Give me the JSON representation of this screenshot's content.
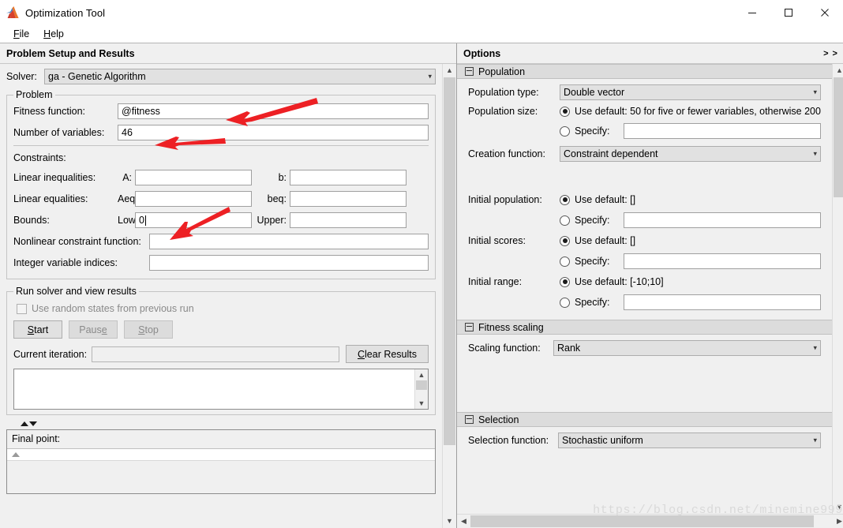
{
  "window": {
    "title": "Optimization Tool",
    "icon": "matlab-membrane-icon",
    "minimize_label": "–",
    "maximize_label": "□",
    "close_label": "✕"
  },
  "menubar": {
    "items": [
      {
        "label": "File",
        "mnemonic": "F"
      },
      {
        "label": "Help",
        "mnemonic": "H"
      }
    ]
  },
  "left_pane": {
    "header": "Problem Setup and Results",
    "solver": {
      "label": "Solver:",
      "value": "ga - Genetic Algorithm"
    },
    "problem": {
      "legend": "Problem",
      "fitness_function": {
        "label": "Fitness function:",
        "value": "@fitness"
      },
      "number_of_variables": {
        "label": "Number of variables:",
        "value": "46"
      },
      "constraints_label": "Constraints:",
      "linear_inequalities": {
        "label": "Linear inequalities:",
        "a_label": "A:",
        "a_value": "",
        "b_label": "b:",
        "b_value": ""
      },
      "linear_equalities": {
        "label": "Linear equalities:",
        "aeq_label": "Aeq:",
        "aeq_value": "",
        "beq_label": "beq:",
        "beq_value": ""
      },
      "bounds": {
        "label": "Bounds:",
        "lower_label": "Lower:",
        "lower_value": "0",
        "upper_label": "Upper:",
        "upper_value": ""
      },
      "nonlinear_constraint": {
        "label": "Nonlinear constraint function:",
        "value": ""
      },
      "integer_variable_indices": {
        "label": "Integer variable indices:",
        "value": ""
      }
    },
    "run_solver": {
      "legend": "Run solver and view results",
      "use_random_states": {
        "label": "Use random states from previous run",
        "checked": false,
        "disabled": true
      },
      "start_button": "Start",
      "pause_button": "Pause",
      "stop_button": "Stop",
      "current_iteration": {
        "label": "Current iteration:",
        "value": ""
      },
      "clear_results_button": "Clear Results",
      "results_text": ""
    },
    "final_point": {
      "label": "Final point:",
      "value": ""
    }
  },
  "right_pane": {
    "header": "Options",
    "expander": "> >",
    "sections": [
      {
        "name": "Population",
        "rows": [
          {
            "type": "combo",
            "label": "Population type:",
            "value": "Double vector"
          },
          {
            "type": "radio_default",
            "label": "Population size:",
            "default_text": "Use default: 50 for five or fewer variables, otherwise 200",
            "selected": "default"
          },
          {
            "type": "radio_specify",
            "label": "",
            "specify_text": "Specify:",
            "value": ""
          },
          {
            "type": "combo",
            "label": "Creation function:",
            "value": "Constraint dependent"
          },
          {
            "type": "radio_default",
            "label": "Initial population:",
            "default_text": "Use default: []",
            "selected": "default"
          },
          {
            "type": "radio_specify",
            "label": "",
            "specify_text": "Specify:",
            "value": ""
          },
          {
            "type": "radio_default",
            "label": "Initial scores:",
            "default_text": "Use default: []",
            "selected": "default"
          },
          {
            "type": "radio_specify",
            "label": "",
            "specify_text": "Specify:",
            "value": ""
          },
          {
            "type": "radio_default",
            "label": "Initial range:",
            "default_text": "Use default: [-10;10]",
            "selected": "default"
          },
          {
            "type": "radio_specify",
            "label": "",
            "specify_text": "Specify:",
            "value": ""
          }
        ]
      },
      {
        "name": "Fitness scaling",
        "rows": [
          {
            "type": "combo",
            "label": "Scaling function:",
            "value": "Rank"
          }
        ]
      },
      {
        "name": "Selection",
        "rows": [
          {
            "type": "combo",
            "label": "Selection function:",
            "value": "Stochastic uniform"
          }
        ]
      }
    ]
  },
  "watermark": "https://blog.csdn.net/minemine999",
  "annotations": {
    "arrow_color": "#ED2024",
    "arrows": [
      {
        "name": "arrow-to-fitness-function"
      },
      {
        "name": "arrow-to-number-of-variables"
      },
      {
        "name": "arrow-to-lower-bound"
      }
    ]
  },
  "colors": {
    "window_bg": "#ffffff",
    "panel_bg": "#f0f0f0",
    "section_header_bg": "#dcdcdc",
    "field_bg": "#ffffff",
    "combo_bg": "#e1e1e1",
    "border": "#a0a0a0",
    "disabled_text": "#8a8a8a"
  }
}
